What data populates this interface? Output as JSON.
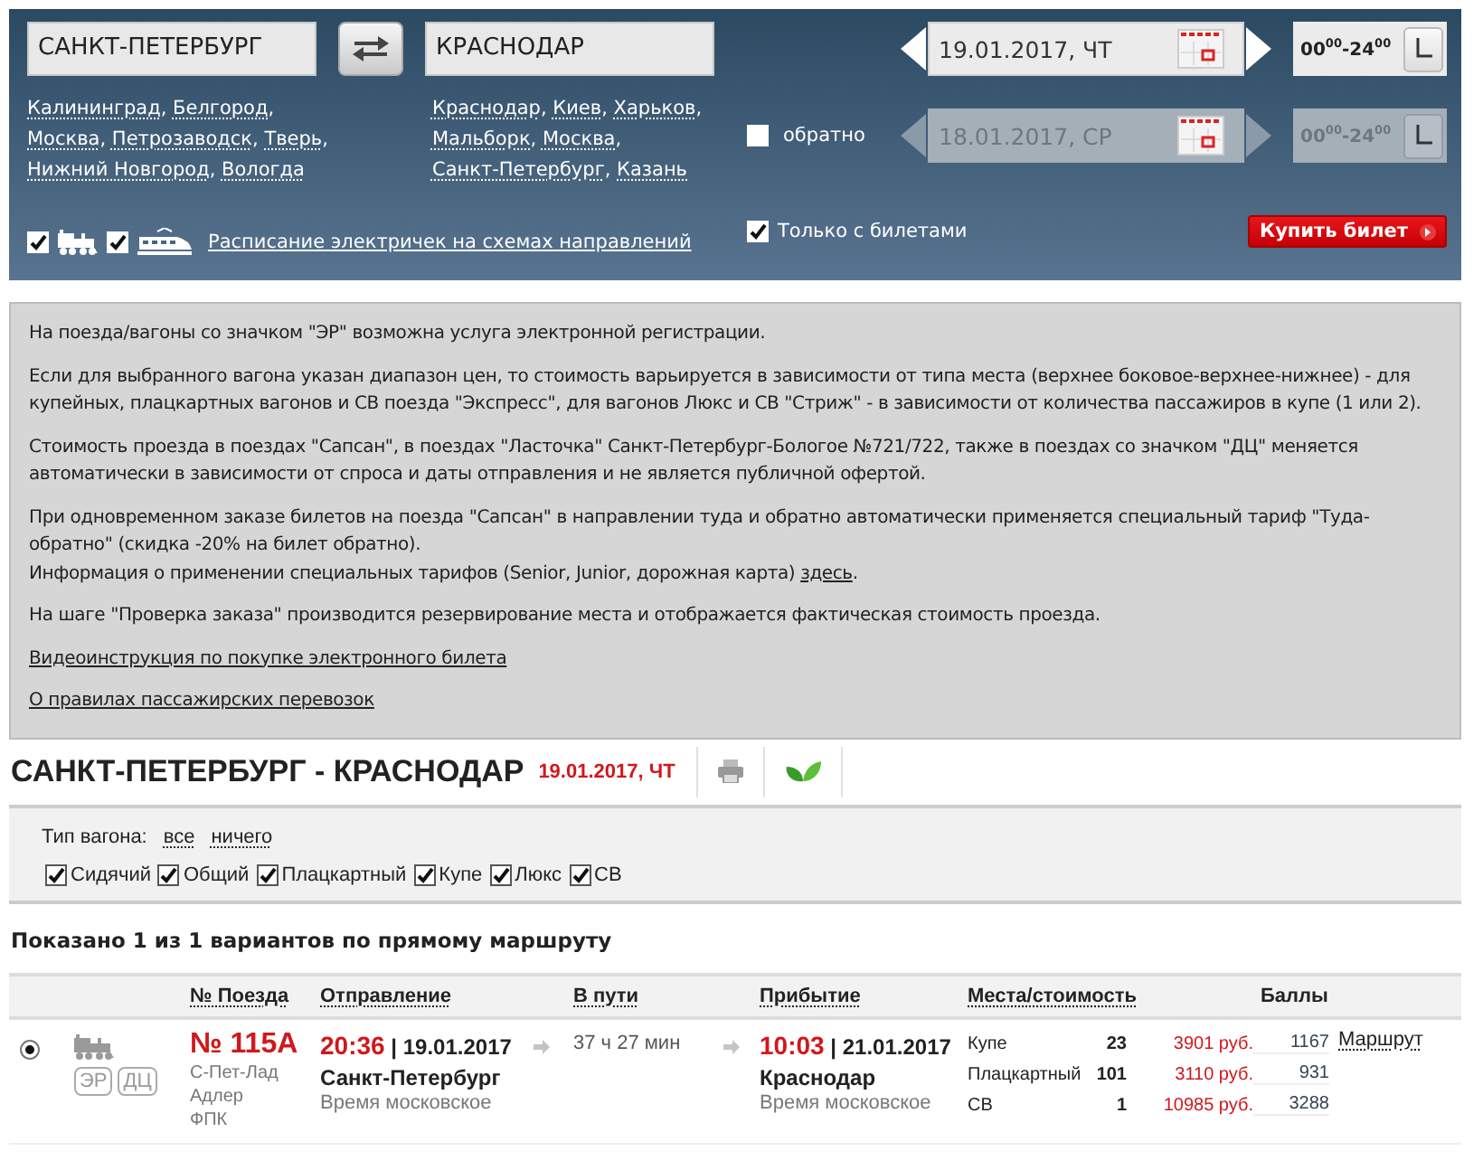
{
  "search": {
    "from": {
      "value": "САНКТ-ПЕТЕРБУРГ",
      "suggestions": [
        "Калининград",
        "Белгород",
        "Москва",
        "Петрозаводск",
        "Тверь",
        "Нижний Новгород",
        "Вологда"
      ]
    },
    "to": {
      "value": "КРАСНОДАР",
      "suggestions": [
        "Краснодар",
        "Киев",
        "Харьков",
        "Мальборк",
        "Москва",
        "Санкт-Петербург",
        "Казань"
      ]
    },
    "separator": ",",
    "date": "19.01.2017, ЧТ",
    "time": "00$^{00}$-24$^{00}$",
    "return": {
      "label": "обратно",
      "checked": false,
      "disabled": true,
      "date": "18.01.2017, СР",
      "time": "00$^{00}$-24$^{00}$"
    },
    "transport": [
      {
        "kind": "train",
        "checked": true
      },
      {
        "kind": "suburban",
        "checked": true
      }
    ],
    "schedule_link": "Расписание электричек на схемах направлений",
    "only_with_tickets": {
      "label": "Только с билетами",
      "checked": true
    },
    "buy_button": "Купить билет"
  },
  "info": {
    "items": [
      {
        "kind": "paragraph",
        "text": "На поезда/вагоны со значком \"ЭР\" возможна услуга электронной регистрации."
      },
      {
        "kind": "paragraph",
        "text": "Если для выбранного вагона указан диапазон цен, то стоимость варьируется в зависимости от типа места (верхнее боковое-верхнее-нижнее) - для купейных, плацкартных вагонов и СВ поезда \"Экспресс\", для вагонов Люкс и СВ \"Стриж\" - в зависимости от количества пассажиров в купе (1 или 2)."
      },
      {
        "kind": "paragraph",
        "text": "Стоимость проезда в поездах \"Сапсан\", в поездах \"Ласточка\" Санкт-Петербург-Бологое №721/722, также в поездах со значком \"ДЦ\" меняется автоматически в зависимости от спроса и даты отправления и не является публичной офертой."
      },
      {
        "kind": "paragraph",
        "text": "При одновременном заказе билетов на поезда \"Сапсан\" в направлении туда и обратно автоматически применяется специальный тариф \"Туда-обратно\" (скидка -20% на билет обратно)."
      },
      {
        "kind": "note",
        "text": "Информация о применении специальных тарифов (Senior, Junior, дорожная карта) ",
        "link": "здесь",
        "after": "."
      },
      {
        "kind": "paragraph",
        "text": "На шаге \"Проверка заказа\" производится резервирование места и отображается фактическая стоимость проезда."
      },
      {
        "kind": "link",
        "text": "Видеоинструкция по покупке электронного билета"
      },
      {
        "kind": "link",
        "text": "О правилах пассажирских перевозок"
      }
    ]
  },
  "results": {
    "title": "САНКТ-ПЕТЕРБУРГ - КРАСНОДАР",
    "date": "19.01.2017, ЧТ",
    "filter": {
      "label": "Тип вагона:",
      "options": [
        "все",
        "ничего"
      ],
      "car_types": [
        {
          "label": "Сидячий",
          "checked": true
        },
        {
          "label": "Общий",
          "checked": true
        },
        {
          "label": "Плацкартный",
          "checked": true
        },
        {
          "label": "Купе",
          "checked": true
        },
        {
          "label": "Люкс",
          "checked": true
        },
        {
          "label": "СВ",
          "checked": true
        }
      ]
    },
    "summary": "Показано 1 из 1 вариантов по прямому маршруту",
    "columns": [
      "№ Поезда",
      "Отправление",
      "В пути",
      "Прибытие",
      "Места/стоимость",
      "Баллы"
    ],
    "rows": [
      {
        "selected": true,
        "badges": [
          "ЭР",
          "ДЦ"
        ],
        "number": "№ 115А",
        "route": [
          "С-Пет-Лад",
          "Адлер"
        ],
        "carrier": "ФПК",
        "departure": {
          "time": "20:36",
          "date": "19.01.2017",
          "station": "Санкт-Петербург",
          "timezone": "Время московское"
        },
        "divider": "|",
        "duration": "37 ч 27 мин",
        "arrival": {
          "time": "10:03",
          "date": "21.01.2017",
          "station": "Краснодар",
          "timezone": "Время московское"
        },
        "seats": [
          {
            "type": "Купе",
            "count": "23",
            "price": "3901 руб.",
            "points": "1167"
          },
          {
            "type": "Плацкартный",
            "count": "101",
            "price": "3110 руб.",
            "points": "931"
          },
          {
            "type": "СВ",
            "count": "1",
            "price": "10985 руб.",
            "points": "3288"
          }
        ],
        "route_link": "Маршрут"
      }
    ]
  }
}
